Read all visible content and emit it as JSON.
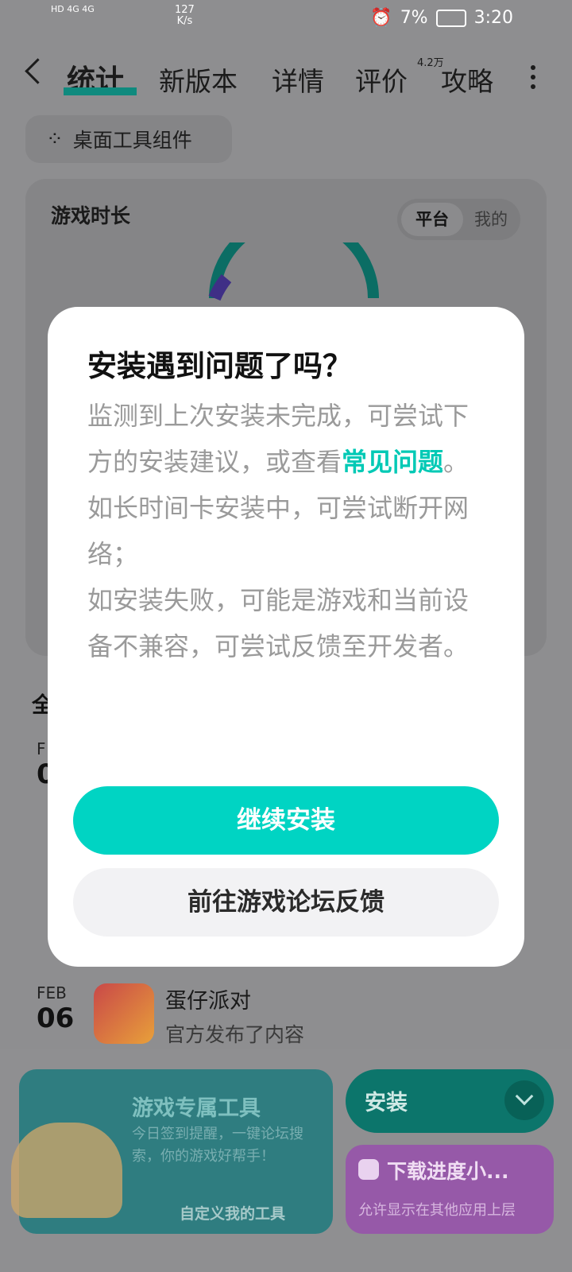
{
  "status": {
    "left_text": "HD 4G 4G",
    "speed": "127",
    "speed_unit": "K/s",
    "battery": "7%",
    "time": "3:20"
  },
  "nav": {
    "tabs": [
      {
        "label": "统计"
      },
      {
        "label": "新版本"
      },
      {
        "label": "详情"
      },
      {
        "label": "评价"
      },
      {
        "label": "攻略"
      }
    ],
    "review_badge": "4.2万"
  },
  "widget_button": {
    "label": "桌面工具组件"
  },
  "playtime_card": {
    "title": "游戏时长",
    "segment": {
      "on": "平台",
      "off": "我的"
    }
  },
  "list": {
    "head": "全",
    "items": [
      {
        "month": "F",
        "day": "0"
      },
      {
        "month": "FEB",
        "day": "06",
        "title": "蛋仔派对",
        "subtitle": "官方发布了内容"
      }
    ]
  },
  "bottom": {
    "tool_card": {
      "title": "游戏专属工具",
      "desc": "今日签到提醒，一键论坛搜索，你的游戏好帮手！",
      "link": "自定义我的工具"
    },
    "install": {
      "label": "安装"
    },
    "download": {
      "title": "下载进度小...",
      "subtitle": "允许显示在其他应用上层"
    }
  },
  "modal": {
    "title": "安装遇到问题了吗？",
    "body_1": "监测到上次安装未完成，可尝试下方的安装建议，或查看",
    "body_link": "常见问题",
    "body_1_end": "。",
    "body_2": "如长时间卡安装中，可尝试断开网络；",
    "body_3": "如安装失败，可能是游戏和当前设备不兼容，可尝试反馈至开发者。",
    "primary_button": "继续安装",
    "secondary_button": "前往游戏论坛反馈"
  }
}
